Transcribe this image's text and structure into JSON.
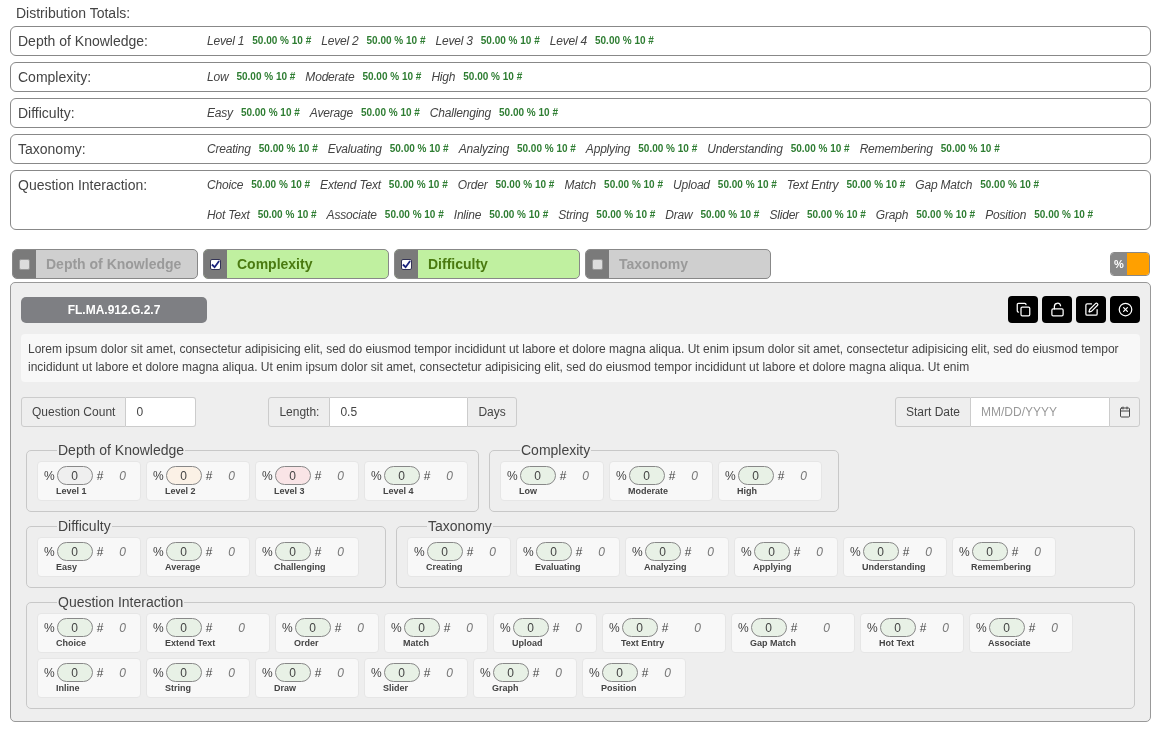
{
  "distribution_totals": {
    "title": "Distribution Totals:",
    "categories": [
      {
        "label": "Depth of Knowledge:",
        "rows": [
          [
            {
              "name": "Level 1",
              "value": "50.00 % 10 #"
            },
            {
              "name": "Level 2",
              "value": "50.00 % 10 #"
            },
            {
              "name": "Level 3",
              "value": "50.00 % 10 #"
            },
            {
              "name": "Level 4",
              "value": "50.00 % 10 #"
            }
          ]
        ]
      },
      {
        "label": "Complexity:",
        "rows": [
          [
            {
              "name": "Low",
              "value": "50.00 % 10 #"
            },
            {
              "name": "Moderate",
              "value": "50.00 % 10 #"
            },
            {
              "name": "High",
              "value": "50.00 % 10 #"
            }
          ]
        ]
      },
      {
        "label": "Difficulty:",
        "rows": [
          [
            {
              "name": "Easy",
              "value": "50.00 % 10 #"
            },
            {
              "name": "Average",
              "value": "50.00 % 10 #"
            },
            {
              "name": "Challenging",
              "value": "50.00 % 10 #"
            }
          ]
        ]
      },
      {
        "label": "Taxonomy:",
        "rows": [
          [
            {
              "name": "Creating",
              "value": "50.00 % 10 #"
            },
            {
              "name": "Evaluating",
              "value": "50.00 % 10 #"
            },
            {
              "name": "Analyzing",
              "value": "50.00 % 10 #"
            },
            {
              "name": "Applying",
              "value": "50.00 % 10 #"
            },
            {
              "name": "Understanding",
              "value": "50.00 % 10 #"
            },
            {
              "name": "Remembering",
              "value": "50.00 % 10 #"
            }
          ]
        ]
      },
      {
        "label": "Question Interaction:",
        "rows": [
          [
            {
              "name": "Choice",
              "value": "50.00 % 10 #"
            },
            {
              "name": "Extend Text",
              "value": "50.00 % 10 #"
            },
            {
              "name": "Order",
              "value": "50.00 % 10 #"
            },
            {
              "name": "Match",
              "value": "50.00 % 10 #"
            },
            {
              "name": "Upload",
              "value": "50.00 % 10 #"
            },
            {
              "name": "Text Entry",
              "value": "50.00 % 10 #"
            },
            {
              "name": "Gap Match",
              "value": "50.00 % 10 #"
            }
          ],
          [
            {
              "name": "Hot Text",
              "value": "50.00 % 10 #"
            },
            {
              "name": "Associate",
              "value": "50.00 % 10 #"
            },
            {
              "name": "Inline",
              "value": "50.00 % 10 #"
            },
            {
              "name": "String",
              "value": "50.00 % 10 #"
            },
            {
              "name": "Draw",
              "value": "50.00 % 10 #"
            },
            {
              "name": "Slider",
              "value": "50.00 % 10 #"
            },
            {
              "name": "Graph",
              "value": "50.00 % 10 #"
            },
            {
              "name": "Position",
              "value": "50.00 % 10 #"
            }
          ]
        ]
      }
    ]
  },
  "filters": [
    {
      "label": "Depth of Knowledge",
      "checked": false
    },
    {
      "label": "Complexity",
      "checked": true
    },
    {
      "label": "Difficulty",
      "checked": true
    },
    {
      "label": "Taxonomy",
      "checked": false
    }
  ],
  "percent_toggle": {
    "label": "%",
    "on": true
  },
  "card": {
    "code": "FL.MA.912.G.2.7",
    "description": "Lorem ipsum dolor sit amet, consectetur adipisicing elit, sed do eiusmod tempor incididunt ut labore et dolore magna aliqua. Ut enim ipsum dolor sit amet, consectetur adipisicing elit, sed do eiusmod tempor incididunt ut labore et dolore magna aliqua. Ut enim ipsum dolor sit amet, consectetur adipisicing elit, sed do eiusmod tempor incididunt ut labore et dolore magna aliqua. Ut enim",
    "question_count": {
      "label": "Question Count",
      "value": "0"
    },
    "length": {
      "label": "Length:",
      "value": "0.5",
      "unit": "Days"
    },
    "start_date": {
      "label": "Start Date",
      "placeholder": "MM/DD/YYYY"
    },
    "group_rows": [
      [
        {
          "title": "Depth of Knowledge",
          "items": [
            {
              "percent_symbol": "%",
              "value": "0",
              "count_symbol": "#",
              "count": "0",
              "label": "Level 1",
              "color": "#efefef"
            },
            {
              "percent_symbol": "%",
              "value": "0",
              "count_symbol": "#",
              "count": "0",
              "label": "Level 2",
              "color": "#fbf1e6"
            },
            {
              "percent_symbol": "%",
              "value": "0",
              "count_symbol": "#",
              "count": "0",
              "label": "Level 3",
              "color": "#f9e4e6"
            },
            {
              "percent_symbol": "%",
              "value": "0",
              "count_symbol": "#",
              "count": "0",
              "label": "Level 4",
              "color": "#e8f1e6"
            }
          ]
        },
        {
          "title": "Complexity",
          "items": [
            {
              "percent_symbol": "%",
              "value": "0",
              "count_symbol": "#",
              "count": "0",
              "label": "Low",
              "color": "#e8f1e6"
            },
            {
              "percent_symbol": "%",
              "value": "0",
              "count_symbol": "#",
              "count": "0",
              "label": "Moderate",
              "color": "#e8f1e6"
            },
            {
              "percent_symbol": "%",
              "value": "0",
              "count_symbol": "#",
              "count": "0",
              "label": "High",
              "color": "#e8f1e6"
            }
          ]
        }
      ],
      [
        {
          "title": "Difficulty",
          "items": [
            {
              "percent_symbol": "%",
              "value": "0",
              "count_symbol": "#",
              "count": "0",
              "label": "Easy",
              "color": "#e8f1e6"
            },
            {
              "percent_symbol": "%",
              "value": "0",
              "count_symbol": "#",
              "count": "0",
              "label": "Average",
              "color": "#e8f1e6"
            },
            {
              "percent_symbol": "%",
              "value": "0",
              "count_symbol": "#",
              "count": "0",
              "label": "Challenging",
              "color": "#e8f1e6"
            }
          ]
        },
        {
          "title": "Taxonomy",
          "items": [
            {
              "percent_symbol": "%",
              "value": "0",
              "count_symbol": "#",
              "count": "0",
              "label": "Creating",
              "color": "#e8f1e6"
            },
            {
              "percent_symbol": "%",
              "value": "0",
              "count_symbol": "#",
              "count": "0",
              "label": "Evaluating",
              "color": "#e8f1e6"
            },
            {
              "percent_symbol": "%",
              "value": "0",
              "count_symbol": "#",
              "count": "0",
              "label": "Analyzing",
              "color": "#e8f1e6"
            },
            {
              "percent_symbol": "%",
              "value": "0",
              "count_symbol": "#",
              "count": "0",
              "label": "Applying",
              "color": "#e8f1e6"
            },
            {
              "percent_symbol": "%",
              "value": "0",
              "count_symbol": "#",
              "count": "0",
              "label": "Understanding",
              "color": "#e8f1e6"
            },
            {
              "percent_symbol": "%",
              "value": "0",
              "count_symbol": "#",
              "count": "0",
              "label": "Remembering",
              "color": "#e8f1e6"
            }
          ]
        }
      ],
      [
        {
          "title": "Question Interaction",
          "items": [
            {
              "percent_symbol": "%",
              "value": "0",
              "count_symbol": "#",
              "count": "0",
              "label": "Choice",
              "color": "#e8f1e6"
            },
            {
              "percent_symbol": "%",
              "value": "0",
              "count_symbol": "#",
              "count": "0",
              "label": "Extend Text",
              "color": "#e8f1e6"
            },
            {
              "percent_symbol": "%",
              "value": "0",
              "count_symbol": "#",
              "count": "0",
              "label": "Order",
              "color": "#e8f1e6"
            },
            {
              "percent_symbol": "%",
              "value": "0",
              "count_symbol": "#",
              "count": "0",
              "label": "Match",
              "color": "#e8f1e6"
            },
            {
              "percent_symbol": "%",
              "value": "0",
              "count_symbol": "#",
              "count": "0",
              "label": "Upload",
              "color": "#e8f1e6"
            },
            {
              "percent_symbol": "%",
              "value": "0",
              "count_symbol": "#",
              "count": "0",
              "label": "Text Entry",
              "color": "#e8f1e6"
            },
            {
              "percent_symbol": "%",
              "value": "0",
              "count_symbol": "#",
              "count": "0",
              "label": "Gap Match",
              "color": "#e8f1e6"
            },
            {
              "percent_symbol": "%",
              "value": "0",
              "count_symbol": "#",
              "count": "0",
              "label": "Hot Text",
              "color": "#e8f1e6"
            },
            {
              "percent_symbol": "%",
              "value": "0",
              "count_symbol": "#",
              "count": "0",
              "label": "Associate",
              "color": "#e8f1e6"
            },
            {
              "percent_symbol": "%",
              "value": "0",
              "count_symbol": "#",
              "count": "0",
              "label": "Inline",
              "color": "#e8f1e6"
            },
            {
              "percent_symbol": "%",
              "value": "0",
              "count_symbol": "#",
              "count": "0",
              "label": "String",
              "color": "#e8f1e6"
            },
            {
              "percent_symbol": "%",
              "value": "0",
              "count_symbol": "#",
              "count": "0",
              "label": "Draw",
              "color": "#e8f1e6"
            },
            {
              "percent_symbol": "%",
              "value": "0",
              "count_symbol": "#",
              "count": "0",
              "label": "Slider",
              "color": "#e8f1e6"
            },
            {
              "percent_symbol": "%",
              "value": "0",
              "count_symbol": "#",
              "count": "0",
              "label": "Graph",
              "color": "#e8f1e6"
            },
            {
              "percent_symbol": "%",
              "value": "0",
              "count_symbol": "#",
              "count": "0",
              "label": "Position",
              "color": "#e8f1e6"
            }
          ]
        }
      ]
    ]
  }
}
